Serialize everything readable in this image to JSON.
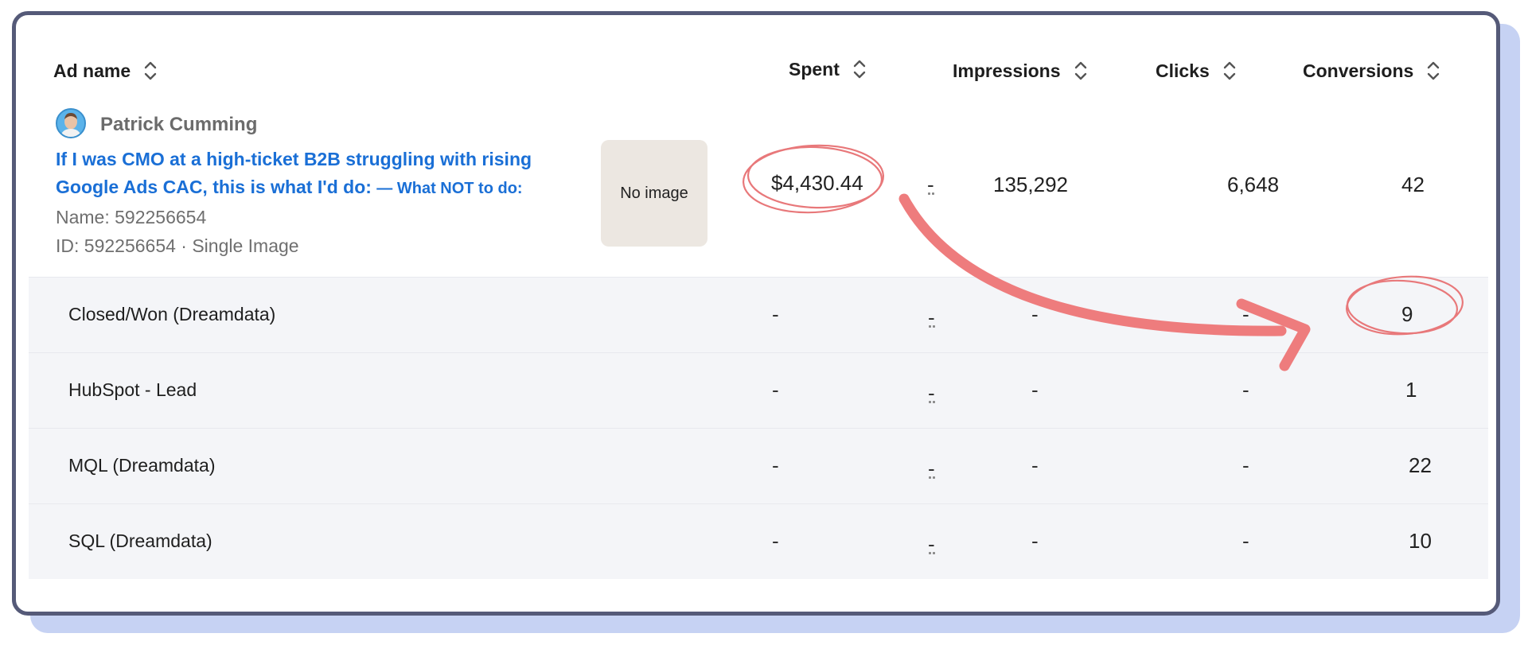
{
  "table": {
    "headers": {
      "ad_name": "Ad name",
      "spent": "Spent",
      "impressions": "Impressions",
      "clicks": "Clicks",
      "conversions": "Conversions"
    },
    "ad": {
      "author": "Patrick Cumming",
      "headline_main": "If I was CMO at a high-ticket B2B struggling with rising Google Ads CAC, this is what I'd do:",
      "headline_suffix": "— What NOT to do:",
      "name_line": "Name: 592256654",
      "id_line": "ID: 592256654 · Single Image",
      "image_placeholder": "No image",
      "spent": "$4,430.44",
      "separator": "-",
      "impressions": "135,292",
      "clicks": "6,648",
      "conversions": "42"
    },
    "conversion_rows": [
      {
        "label": "Closed/Won (Dreamdata)",
        "spent": "-",
        "separator": "-",
        "impressions": "-",
        "clicks": "-",
        "conversions": "9"
      },
      {
        "label": "HubSpot - Lead",
        "spent": "-",
        "separator": "-",
        "impressions": "-",
        "clicks": "-",
        "conversions": "1"
      },
      {
        "label": "MQL (Dreamdata)",
        "spent": "-",
        "separator": "-",
        "impressions": "-",
        "clicks": "-",
        "conversions": "22"
      },
      {
        "label": "SQL (Dreamdata)",
        "spent": "-",
        "separator": "-",
        "impressions": "-",
        "clicks": "-",
        "conversions": "10"
      }
    ]
  },
  "annotation": {
    "color": "#e8787a",
    "circled_values": [
      "$4,430.44",
      "9"
    ],
    "arrow": "from spent value to Closed/Won conversions"
  },
  "colors": {
    "link": "#1a6fd6",
    "card_border": "#555a78",
    "card_shadow": "#c6d2f3",
    "row_bg": "#f4f5f8"
  }
}
